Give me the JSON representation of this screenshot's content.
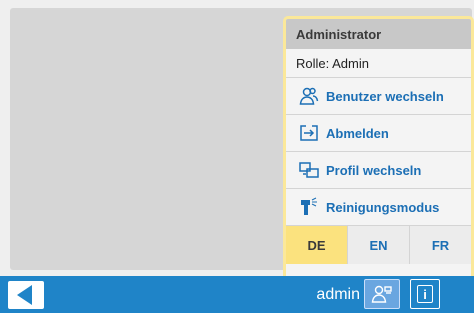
{
  "popup": {
    "title": "Administrator",
    "role": "Rolle: Admin",
    "items": [
      {
        "label": "Benutzer wechseln",
        "icon": "users-switch-icon"
      },
      {
        "label": "Abmelden",
        "icon": "logout-icon"
      },
      {
        "label": "Profil wechseln",
        "icon": "profile-switch-icon"
      },
      {
        "label": "Reinigungsmodus",
        "icon": "cleaning-spray-icon"
      }
    ],
    "languages": [
      "DE",
      "EN",
      "FR"
    ],
    "active_language": "DE"
  },
  "taskbar": {
    "username": "admin",
    "back_icon": "back-arrow-icon",
    "user_icon": "user-icon",
    "info_icon": "info-icon"
  },
  "colors": {
    "accent": "#1f84c8",
    "link": "#1c6fb5",
    "highlight": "#fbe27e",
    "popup_border": "#fbe89a"
  }
}
